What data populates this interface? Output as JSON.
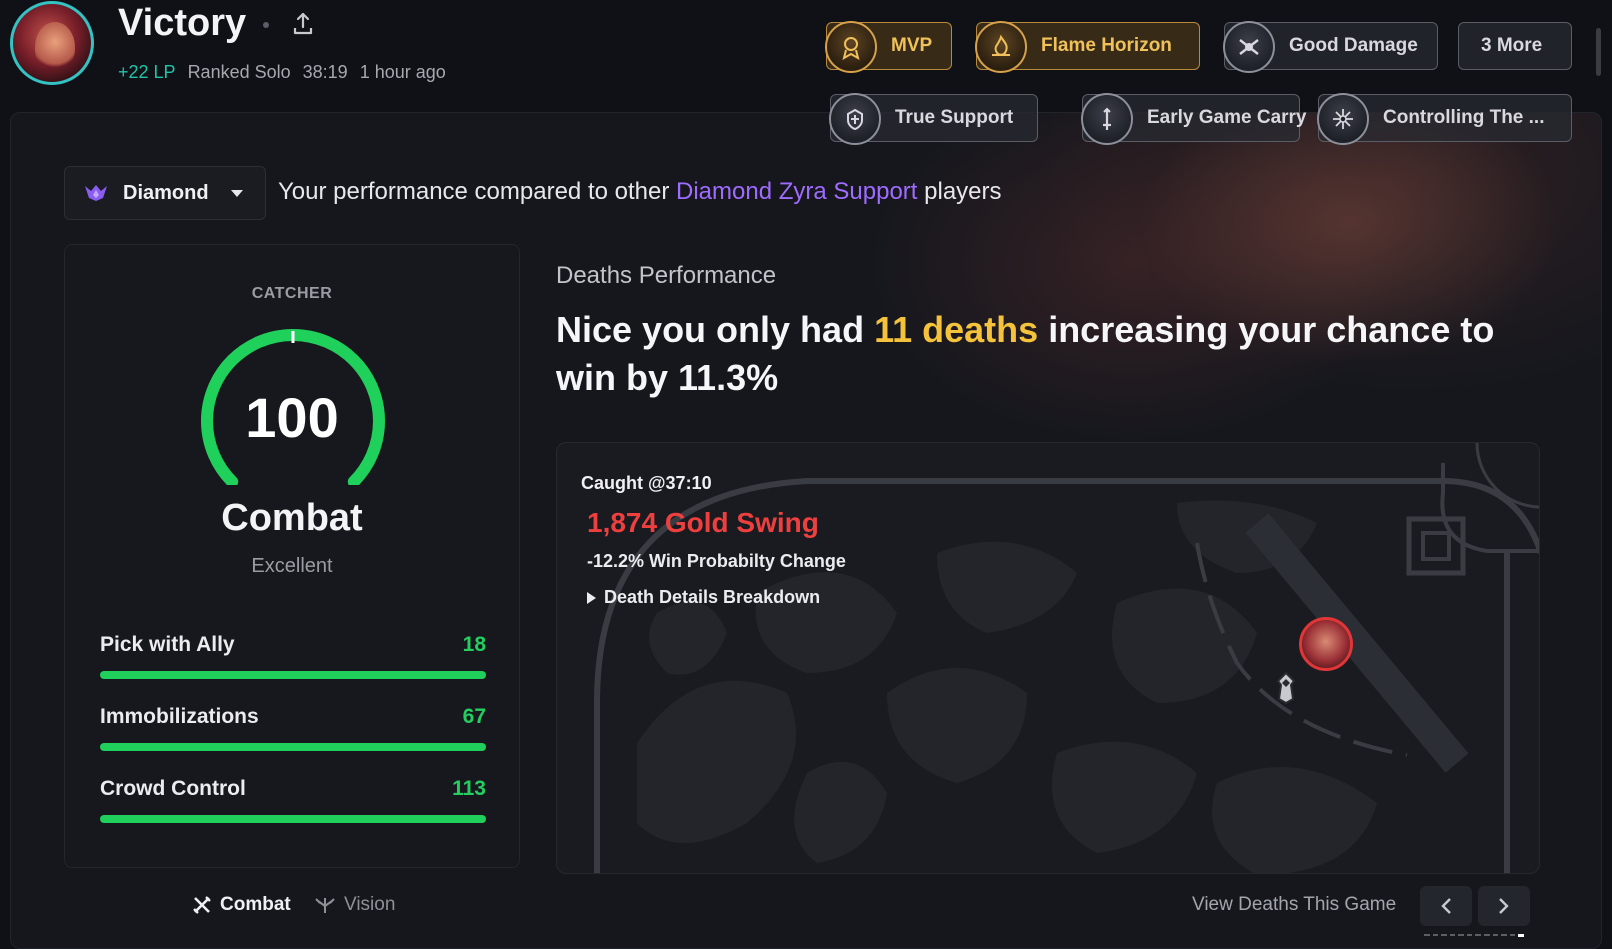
{
  "header": {
    "result": "Victory",
    "lp": "+22 LP",
    "queue": "Ranked Solo",
    "duration": "38:19",
    "time_ago": "1 hour ago"
  },
  "badges": [
    {
      "label": "MVP",
      "style": "gold",
      "icon": "mvp-icon"
    },
    {
      "label": "Flame Horizon",
      "style": "gold",
      "icon": "flame-horizon-icon"
    },
    {
      "label": "Good Damage",
      "style": "silver",
      "icon": "good-damage-icon"
    },
    {
      "label": "3 More",
      "style": "more"
    },
    {
      "label": "True Support",
      "style": "silver",
      "icon": "true-support-icon"
    },
    {
      "label": "Early Game Carry",
      "style": "silver",
      "icon": "early-game-carry-icon"
    },
    {
      "label": "Controlling The ...",
      "style": "silver",
      "icon": "controlling-icon"
    }
  ],
  "rank_filter": {
    "selected": "Diamond"
  },
  "compare": {
    "prefix": "Your performance compared to other",
    "highlight": "Diamond Zyra Support",
    "suffix": "players"
  },
  "score_card": {
    "role": "CATCHER",
    "score": "100",
    "score_fraction": 1.0,
    "category": "Combat",
    "rating": "Excellent",
    "stats": [
      {
        "name": "Pick with Ally",
        "value": "18"
      },
      {
        "name": "Immobilizations",
        "value": "67"
      },
      {
        "name": "Crowd Control",
        "value": "113"
      }
    ]
  },
  "tabs": [
    {
      "label": "Combat",
      "active": true,
      "icon": "combat-icon"
    },
    {
      "label": "Vision",
      "active": false,
      "icon": "vision-icon"
    }
  ],
  "deaths": {
    "section_label": "Deaths Performance",
    "headline_pre": "Nice you only had",
    "headline_highlight": "11 deaths",
    "headline_post": "increasing your chance to win by 11.3%",
    "caught": "Caught @37:10",
    "gold_swing": "1,874 Gold Swing",
    "win_prob": "-12.2% Win Probabilty Change",
    "breakdown": "Death Details Breakdown",
    "view_label": "View Deaths This Game"
  },
  "colors": {
    "accent_green": "#22cf5f",
    "accent_gold": "#f5c33b",
    "accent_purple": "#a06bff",
    "lp_teal": "#22c4a8",
    "gold_swing_red": "#ee3f3f"
  }
}
